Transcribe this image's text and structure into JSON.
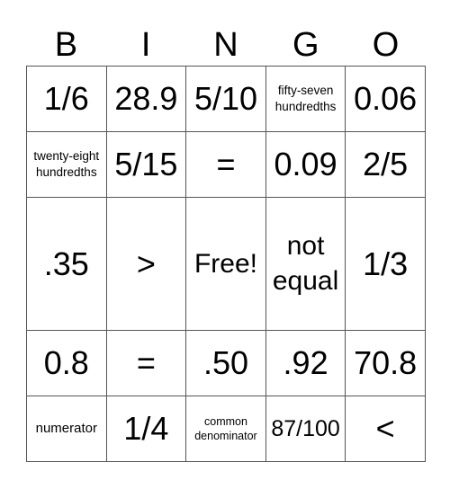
{
  "header": [
    "B",
    "I",
    "N",
    "G",
    "O"
  ],
  "rows": [
    [
      {
        "text": "1/6",
        "size": "xl"
      },
      {
        "text": "28.9",
        "size": "xl"
      },
      {
        "text": "5/10",
        "size": "xl"
      },
      {
        "text": "fifty-seven hundredths",
        "size": "xs"
      },
      {
        "text": "0.06",
        "size": "xl"
      }
    ],
    [
      {
        "text": "twenty-eight hundredths",
        "size": "xs"
      },
      {
        "text": "5/15",
        "size": "xl"
      },
      {
        "text": "=",
        "size": "xl"
      },
      {
        "text": "0.09",
        "size": "xl"
      },
      {
        "text": "2/5",
        "size": "xl"
      }
    ],
    [
      {
        "text": ".35",
        "size": "xl"
      },
      {
        "text": ">",
        "size": "xl"
      },
      {
        "text": "Free!",
        "size": "l"
      },
      {
        "text": "not equal",
        "size": "l"
      },
      {
        "text": "1/3",
        "size": "xl"
      }
    ],
    [
      {
        "text": "0.8",
        "size": "xl"
      },
      {
        "text": "=",
        "size": "xl"
      },
      {
        "text": ".50",
        "size": "xl"
      },
      {
        "text": ".92",
        "size": "xl"
      },
      {
        "text": "70.8",
        "size": "xl"
      }
    ],
    [
      {
        "text": "numerator",
        "size": "s"
      },
      {
        "text": "1/4",
        "size": "xl"
      },
      {
        "text": "common denominator",
        "size": "xxs"
      },
      {
        "text": "87/100",
        "size": "m"
      },
      {
        "text": "<",
        "size": "xl"
      }
    ]
  ]
}
